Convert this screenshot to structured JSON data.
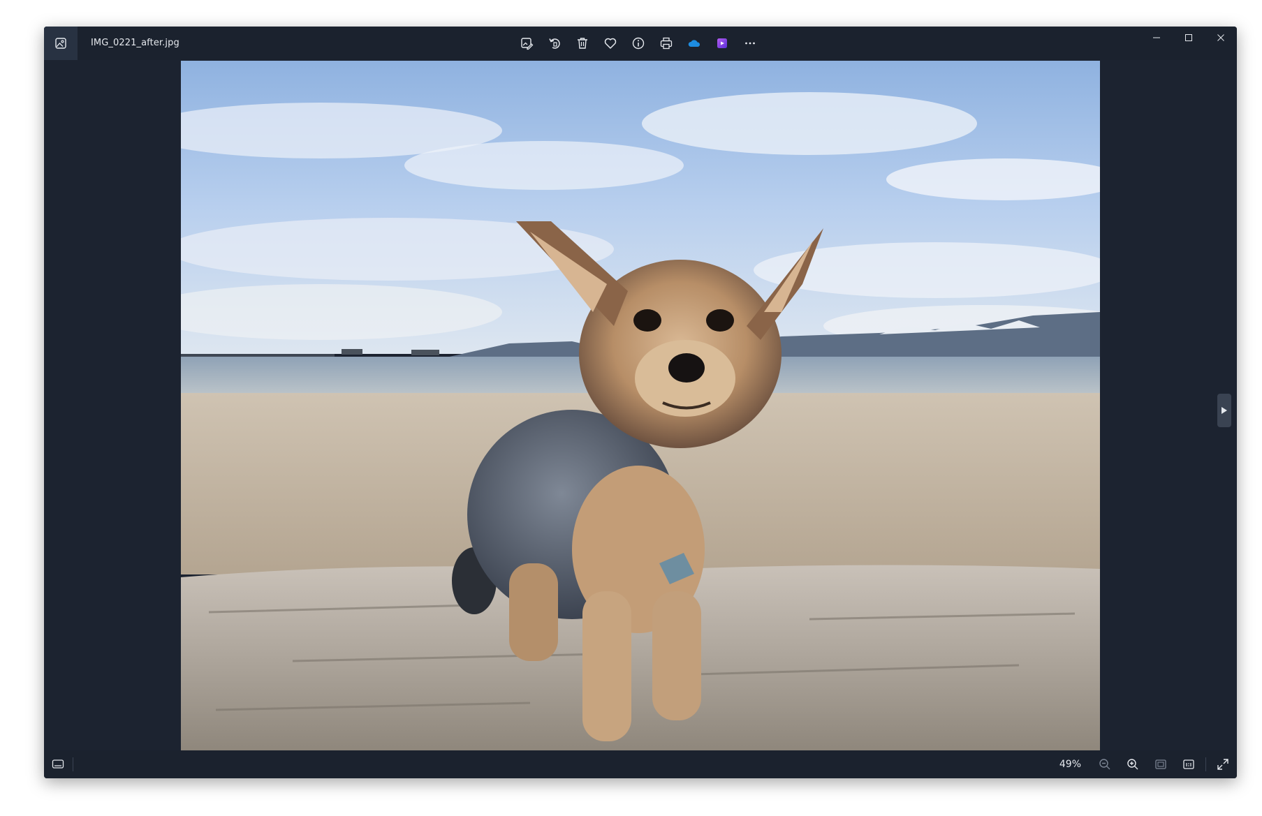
{
  "window": {
    "file_name": "IMG_0221_after.jpg"
  },
  "toolbar": {
    "items": [
      {
        "name": "edit-image",
        "icon": "edit-image-icon"
      },
      {
        "name": "rotate",
        "icon": "rotate-icon"
      },
      {
        "name": "delete",
        "icon": "trash-icon"
      },
      {
        "name": "favorite",
        "icon": "heart-icon"
      },
      {
        "name": "file-info",
        "icon": "info-icon"
      },
      {
        "name": "print",
        "icon": "printer-icon"
      },
      {
        "name": "onedrive",
        "icon": "cloud-icon"
      },
      {
        "name": "clipchamp",
        "icon": "clipchamp-icon"
      },
      {
        "name": "more",
        "icon": "more-icon"
      }
    ]
  },
  "statusbar": {
    "zoom": "49%"
  },
  "colors": {
    "window_bg": "#1c2330",
    "titlebar_bg": "#1b222e",
    "icon_fg": "#e6e9ee",
    "onedrive_blue": "#1d8ce0",
    "clipchamp_purple": "#7b3fe4"
  }
}
